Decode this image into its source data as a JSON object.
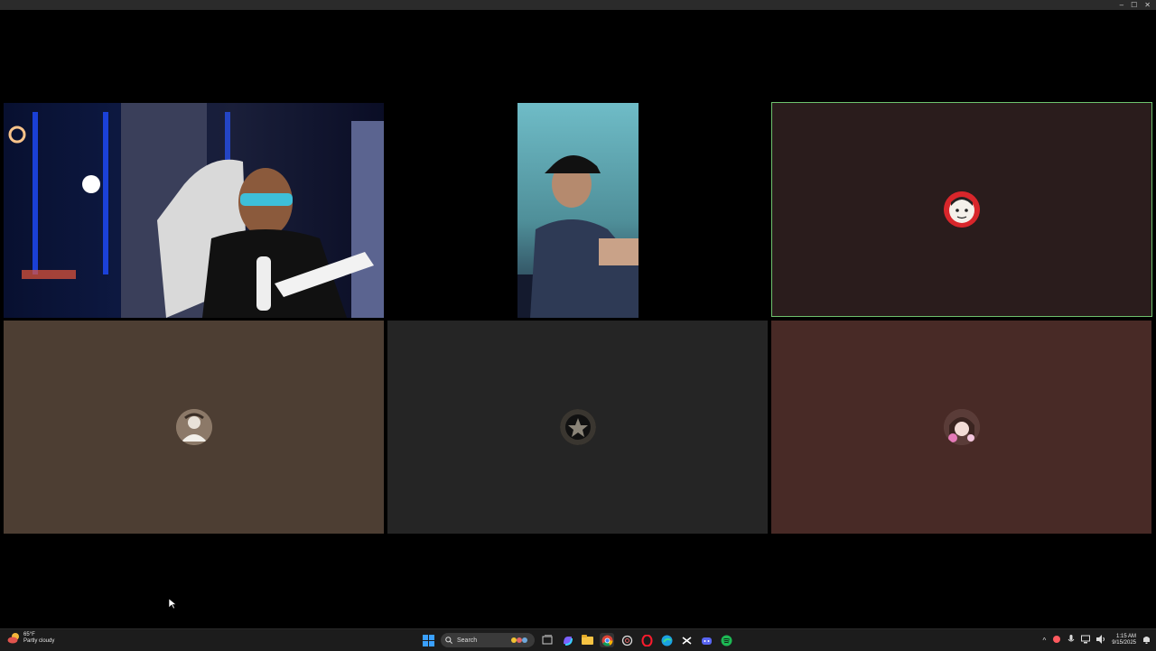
{
  "window": {
    "controls": {
      "minimize": "–",
      "maximize": "☐",
      "close": "✕"
    }
  },
  "tiles": [
    {
      "id": "participant-1",
      "type": "video",
      "bg": "#0c1030"
    },
    {
      "id": "participant-2",
      "type": "video",
      "bg": "#5fa9b5"
    },
    {
      "id": "participant-3",
      "type": "avatar",
      "bg": "#2a1c1c",
      "speaking": true,
      "speaking_color": "#6ec26e"
    },
    {
      "id": "participant-4",
      "type": "avatar",
      "bg": "#4d3e33"
    },
    {
      "id": "participant-5",
      "type": "avatar",
      "bg": "#252525"
    },
    {
      "id": "participant-6",
      "type": "avatar",
      "bg": "#482a26"
    }
  ],
  "taskbar": {
    "weather": {
      "temp": "65°F",
      "condition": "Partly cloudy"
    },
    "search": {
      "placeholder": "Search"
    },
    "pinned": [
      "windows-start-icon",
      "task-view-icon",
      "copilot-icon",
      "file-explorer-icon",
      "chrome-icon",
      "chatgpt-icon",
      "opera-icon",
      "edge-icon",
      "capcut-icon",
      "discord-icon",
      "spotify-icon"
    ],
    "tray": {
      "chevron": "^",
      "time": "1:15 AM",
      "date": "9/15/2025"
    }
  },
  "colors": {
    "accent": "#0a7cff",
    "spotify": "#1db954",
    "discord": "#5865f2"
  }
}
